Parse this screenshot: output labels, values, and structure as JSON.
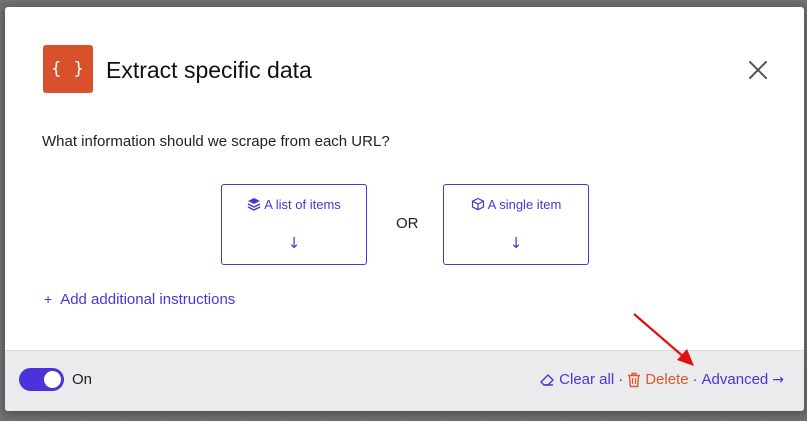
{
  "modal": {
    "icon_text": "{ }",
    "title": "Extract specific data",
    "question": "What information should we scrape from each URL?"
  },
  "options": {
    "list": {
      "label": "A list of items",
      "arrow": "↓"
    },
    "or": "OR",
    "single": {
      "label": "A single item",
      "arrow": "↓"
    }
  },
  "add_instructions": {
    "plus": "+",
    "label": "Add additional instructions"
  },
  "footer": {
    "toggle_label": "On",
    "toggle_on": true,
    "clear_label": "Clear all",
    "separator": "·",
    "delete_label": "Delete",
    "advanced_label": "Advanced",
    "advanced_arrow": "→"
  },
  "colors": {
    "accent": "#4a34d9",
    "brand_icon": "#d9502c",
    "delete": "#e0562f",
    "annotation_arrow": "#e01010"
  },
  "icons": [
    "braces-icon",
    "close-icon",
    "stack-icon",
    "cube-icon",
    "plus-icon",
    "eraser-icon",
    "trash-icon",
    "arrow-right-icon"
  ]
}
